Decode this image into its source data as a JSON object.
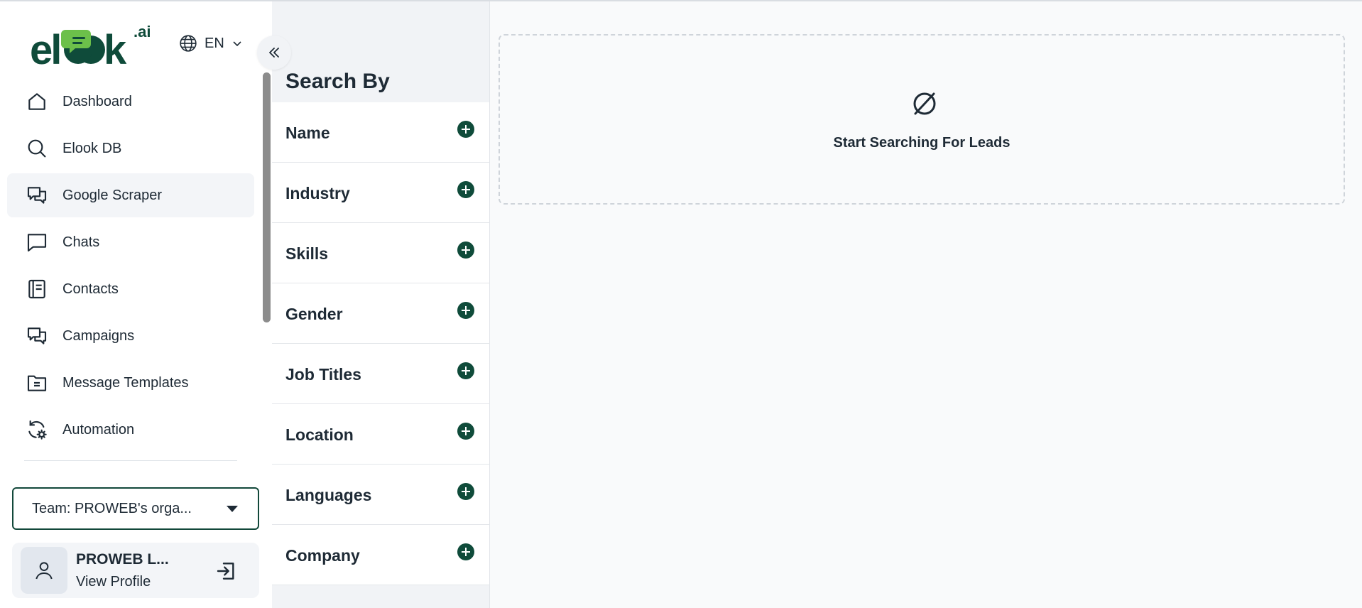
{
  "logo": {
    "main": "elook",
    "suffix": ".ai"
  },
  "language": {
    "code": "EN"
  },
  "nav": [
    {
      "label": "Dashboard",
      "icon": "home-icon"
    },
    {
      "label": "Elook DB",
      "icon": "search-icon"
    },
    {
      "label": "Google Scraper",
      "icon": "chats-icon",
      "active": true
    },
    {
      "label": "Chats",
      "icon": "chat-icon"
    },
    {
      "label": "Contacts",
      "icon": "contacts-book-icon"
    },
    {
      "label": "Campaigns",
      "icon": "campaigns-icon"
    },
    {
      "label": "Message Templates",
      "icon": "folder-icon"
    },
    {
      "label": "Automation",
      "icon": "automation-gear-icon"
    }
  ],
  "team": {
    "label": "Team: PROWEB's orga..."
  },
  "profile": {
    "name": "PROWEB L...",
    "link": "View Profile"
  },
  "search_panel": {
    "title": "Search By",
    "filters": [
      "Name",
      "Industry",
      "Skills",
      "Gender",
      "Job Titles",
      "Location",
      "Languages",
      "Company"
    ]
  },
  "main": {
    "empty_message": "Start Searching For Leads"
  },
  "colors": {
    "brand_green": "#0f4b3a",
    "accent_light_green": "#6cc04a",
    "panel_bg": "#f1f3f6"
  }
}
